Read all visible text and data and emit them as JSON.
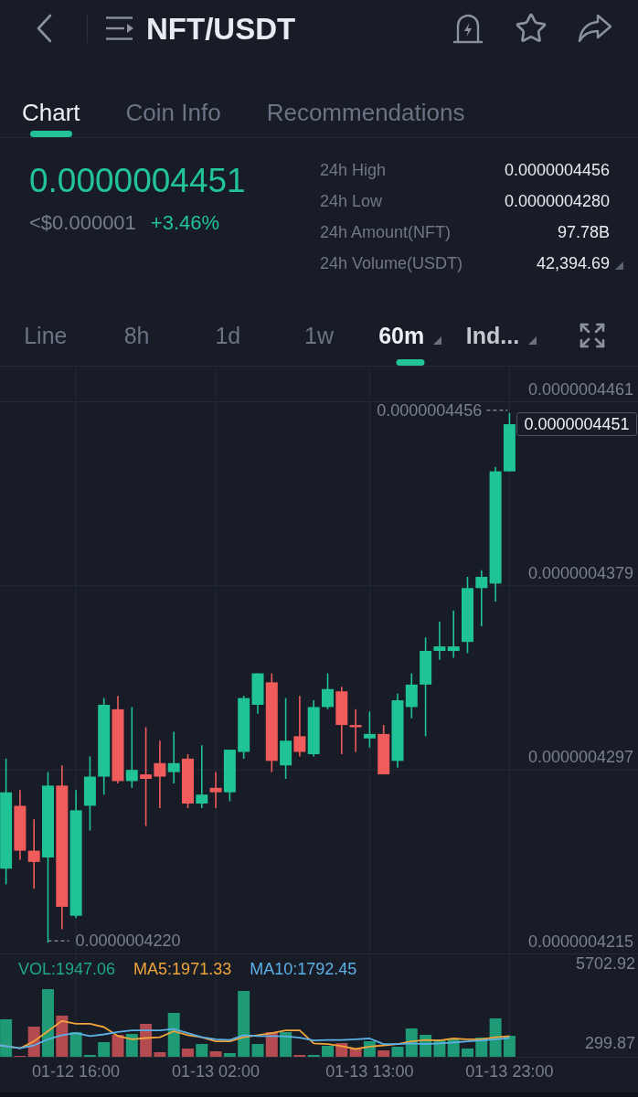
{
  "header": {
    "title": "NFT/USDT"
  },
  "tabs": [
    {
      "label": "Chart",
      "selected": true
    },
    {
      "label": "Coin Info",
      "selected": false
    },
    {
      "label": "Recommendations",
      "selected": false
    }
  ],
  "ticker": {
    "last_price": "0.0000004451",
    "fiat_price": "<$0.000001",
    "change": "+3.46%"
  },
  "stats": [
    {
      "label": "24h High",
      "value": "0.0000004456"
    },
    {
      "label": "24h Low",
      "value": "0.0000004280"
    },
    {
      "label": "24h Amount(NFT)",
      "value": "97.78B"
    },
    {
      "label": "24h Volume(USDT)",
      "value": "42,394.69"
    }
  ],
  "intervals": [
    {
      "label": "Line",
      "kind": "option",
      "selected": false
    },
    {
      "label": "8h",
      "kind": "option",
      "selected": false
    },
    {
      "label": "1d",
      "kind": "option",
      "selected": false
    },
    {
      "label": "1w",
      "kind": "option",
      "selected": false
    },
    {
      "label": "60m",
      "kind": "menu",
      "selected": true
    },
    {
      "label": "Ind...",
      "kind": "menu",
      "selected": false
    }
  ],
  "chart": {
    "chart_data": {
      "type": "candlestick",
      "grid": true,
      "categories": [
        null,
        null,
        null,
        null,
        null,
        "01-12 16:00",
        null,
        null,
        null,
        null,
        null,
        null,
        null,
        null,
        null,
        "01-13 02:00",
        null,
        null,
        null,
        null,
        null,
        null,
        null,
        null,
        null,
        null,
        "01-13 13:00",
        null,
        null,
        null,
        null,
        null,
        null,
        null,
        null,
        null,
        "01-13 23:00"
      ],
      "ohlc": [
        [
          4.253e-07,
          4.302e-07,
          4.246e-07,
          4.287e-07
        ],
        [
          4.281e-07,
          4.288e-07,
          4.257e-07,
          4.261e-07
        ],
        [
          4.261e-07,
          4.275e-07,
          4.244e-07,
          4.256e-07
        ],
        [
          4.258e-07,
          4.296e-07,
          4.22e-07,
          4.29e-07
        ],
        [
          4.29e-07,
          4.299e-07,
          4.226e-07,
          4.236e-07
        ],
        [
          4.232e-07,
          4.288e-07,
          4.231e-07,
          4.279e-07
        ],
        [
          4.281e-07,
          4.303e-07,
          4.27e-07,
          4.294e-07
        ],
        [
          4.294e-07,
          4.329e-07,
          4.286e-07,
          4.326e-07
        ],
        [
          4.324e-07,
          4.33e-07,
          4.291e-07,
          4.292e-07
        ],
        [
          4.292e-07,
          4.325e-07,
          4.289e-07,
          4.297e-07
        ],
        [
          4.295e-07,
          4.316e-07,
          4.272e-07,
          4.293e-07
        ],
        [
          4.3e-07,
          4.31e-07,
          4.28e-07,
          4.294e-07
        ],
        [
          4.296e-07,
          4.314e-07,
          4.291e-07,
          4.3e-07
        ],
        [
          4.302e-07,
          4.304e-07,
          4.28e-07,
          4.282e-07
        ],
        [
          4.282e-07,
          4.308e-07,
          4.28e-07,
          4.286e-07
        ],
        [
          4.289e-07,
          4.296e-07,
          4.28e-07,
          4.287e-07
        ],
        [
          4.287e-07,
          4.306e-07,
          4.283e-07,
          4.306e-07
        ],
        [
          4.305e-07,
          4.33e-07,
          4.302e-07,
          4.329e-07
        ],
        [
          4.326e-07,
          4.34e-07,
          4.322e-07,
          4.34e-07
        ],
        [
          4.336e-07,
          4.34e-07,
          4.296e-07,
          4.301e-07
        ],
        [
          4.299e-07,
          4.329e-07,
          4.293e-07,
          4.31e-07
        ],
        [
          4.312e-07,
          4.33e-07,
          4.303e-07,
          4.305e-07
        ],
        [
          4.304e-07,
          4.328e-07,
          4.303e-07,
          4.325e-07
        ],
        [
          4.325e-07,
          4.34e-07,
          4.324e-07,
          4.333e-07
        ],
        [
          4.332e-07,
          4.334e-07,
          4.304e-07,
          4.317e-07
        ],
        [
          4.317e-07,
          4.324e-07,
          4.305e-07,
          4.316e-07
        ],
        [
          4.311e-07,
          4.323e-07,
          4.307e-07,
          4.313e-07
        ],
        [
          4.313e-07,
          4.317e-07,
          4.295e-07,
          4.295e-07
        ],
        [
          4.301e-07,
          4.331e-07,
          4.298e-07,
          4.328e-07
        ],
        [
          4.325e-07,
          4.34e-07,
          4.32e-07,
          4.335e-07
        ],
        [
          4.335e-07,
          4.356e-07,
          4.312e-07,
          4.35e-07
        ],
        [
          4.35e-07,
          4.363e-07,
          4.346e-07,
          4.352e-07
        ],
        [
          4.35e-07,
          4.368e-07,
          4.347e-07,
          4.352e-07
        ],
        [
          4.354e-07,
          4.383e-07,
          4.349e-07,
          4.378e-07
        ],
        [
          4.378e-07,
          4.386e-07,
          4.361e-07,
          4.383e-07
        ],
        [
          4.38e-07,
          4.432e-07,
          4.372e-07,
          4.43e-07
        ],
        [
          4.43e-07,
          4.456e-07,
          4.43e-07,
          4.451e-07
        ]
      ],
      "ylim": [
        4.215e-07,
        4.461e-07
      ],
      "yticks": [
        {
          "value": 4.461e-07,
          "label": "0.0000004461"
        },
        {
          "value": 4.379e-07,
          "label": "0.0000004379"
        },
        {
          "value": 4.297e-07,
          "label": "0.0000004297"
        },
        {
          "value": 4.215e-07,
          "label": "0.0000004215"
        }
      ]
    },
    "high_marker": "0.0000004456",
    "low_marker": "0.0000004220",
    "price_tag": "0.0000004451",
    "indicators": [
      {
        "label": "VOL:1947.06",
        "color": "#21a886"
      },
      {
        "label": "MA5:1971.33",
        "color": "#f0a43c"
      },
      {
        "label": "MA10:1792.45",
        "color": "#5cb0e6"
      }
    ],
    "volume_axis": [
      "5702.92",
      "299.87"
    ]
  }
}
